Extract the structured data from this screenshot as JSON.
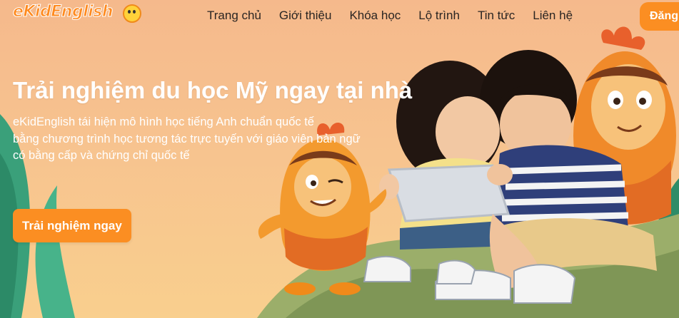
{
  "header": {
    "logo": "eKidEnglish",
    "nav": [
      "Trang chủ",
      "Giới thiệu",
      "Khóa học",
      "Lộ trình",
      "Tin tức",
      "Liên hệ"
    ],
    "login_label": "Đăng"
  },
  "hero": {
    "headline": "Trải nghiệm du học Mỹ ngay tại nhà",
    "desc_lines": [
      "eKidEnglish tái hiện mô hình học tiếng Anh chuẩn quốc tế",
      "bằng chương trình học tương tác trực tuyến với giáo viên bản ngữ",
      "có bằng cấp và chứng chỉ quốc tế"
    ],
    "cta_label": "Trải nghiệm ngay"
  },
  "colors": {
    "accent": "#fb8e22",
    "background_top": "#f5b98c",
    "background_bottom": "#f9cf8e"
  },
  "icons": [
    "logo-smiley-icon"
  ]
}
